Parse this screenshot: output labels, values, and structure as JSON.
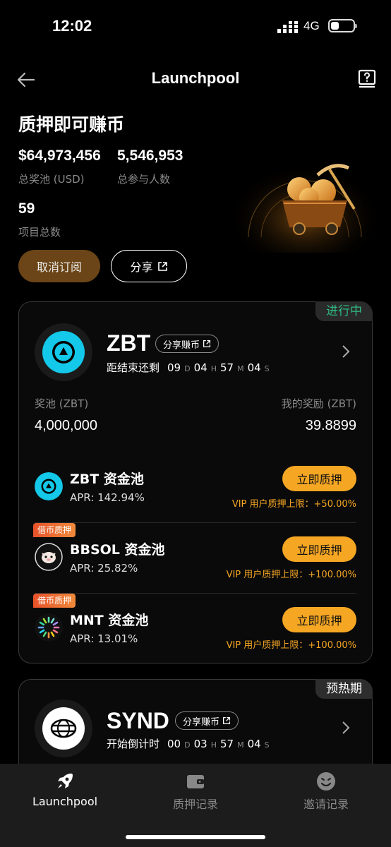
{
  "status": {
    "time": "12:02",
    "network": "4G"
  },
  "nav": {
    "title": "Launchpool"
  },
  "hero": {
    "title": "质押即可赚币",
    "total_pool_value": "$64,973,456",
    "total_pool_label": "总奖池 (USD)",
    "participants_value": "5,546,953",
    "participants_label": "总参与人数",
    "projects_value": "59",
    "projects_label": "项目总数",
    "unsubscribe_label": "取消订阅",
    "share_label": "分享"
  },
  "card_zbt": {
    "status": "进行中",
    "token": "ZBT",
    "share_label": "分享赚币",
    "countdown_label": "距结束还剩",
    "countdown": {
      "d": "09",
      "d_unit": "D",
      "h": "04",
      "h_unit": "H",
      "m": "57",
      "m_unit": "M",
      "s": "04",
      "s_unit": "S"
    },
    "pool_label": "奖池 (ZBT)",
    "pool_value": "4,000,000",
    "my_reward_label": "我的奖励 (ZBT)",
    "my_reward_value": "39.8899",
    "pools": [
      {
        "name": "ZBT 资金池",
        "apr": "APR: 142.94%",
        "button": "立即质押",
        "vip": "VIP 用户质押上限：+50.00%",
        "tag": ""
      },
      {
        "name": "BBSOL 资金池",
        "apr": "APR: 25.82%",
        "button": "立即质押",
        "vip": "VIP 用户质押上限：+100.00%",
        "tag": "借币质押"
      },
      {
        "name": "MNT 资金池",
        "apr": "APR: 13.01%",
        "button": "立即质押",
        "vip": "VIP 用户质押上限：+100.00%",
        "tag": "借币质押"
      }
    ]
  },
  "card_synd": {
    "status": "预热期",
    "token": "SYND",
    "share_label": "分享赚币",
    "countdown_label": "开始倒计时",
    "countdown": {
      "d": "00",
      "d_unit": "D",
      "h": "03",
      "h_unit": "H",
      "m": "57",
      "m_unit": "M",
      "s": "04",
      "s_unit": "S"
    }
  },
  "tabs": [
    {
      "label": "Launchpool",
      "icon": "rocket-icon",
      "active": true
    },
    {
      "label": "质押记录",
      "icon": "wallet-icon",
      "active": false
    },
    {
      "label": "邀请记录",
      "icon": "smiley-icon",
      "active": false
    }
  ],
  "colors": {
    "accent": "#f5a623",
    "active_status": "#2ebd85",
    "unsubscribe_bg": "#6b4517",
    "zbt_brand": "#13c8e8"
  }
}
